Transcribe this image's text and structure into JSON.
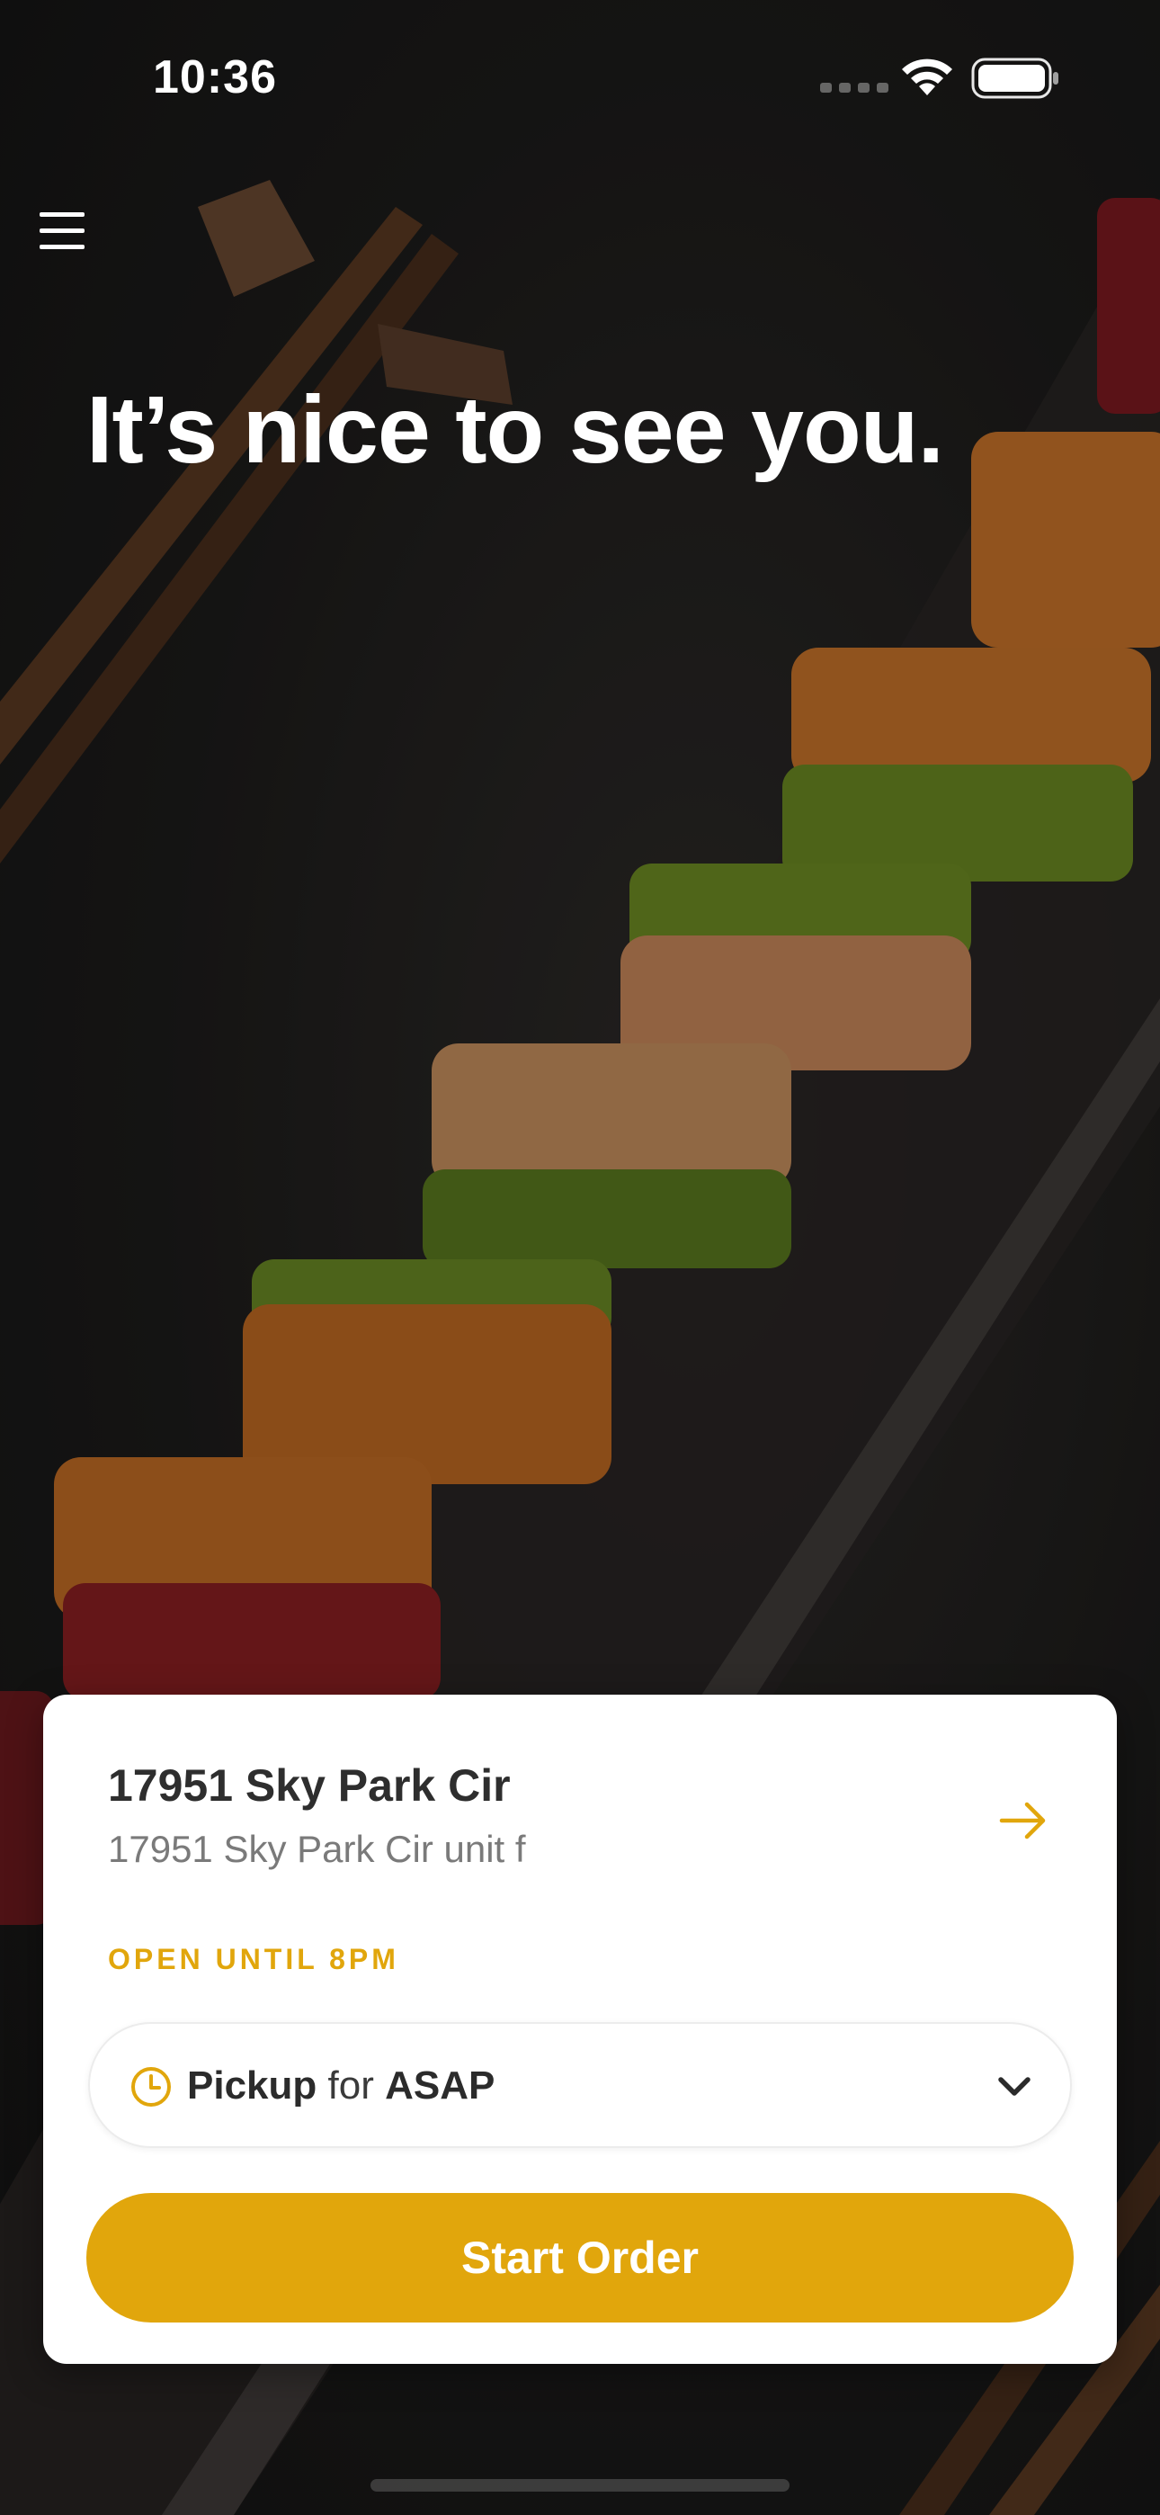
{
  "status_bar": {
    "time": "10:36"
  },
  "hero": {
    "greeting": "It’s nice to see you."
  },
  "location": {
    "name": "17951 Sky Park Cir",
    "address": "17951 Sky Park Cir unit f",
    "hours": "OPEN UNTIL 8PM"
  },
  "order": {
    "mode": "Pickup",
    "connector": "for",
    "time": "ASAP",
    "start_label": "Start Order"
  },
  "colors": {
    "accent": "#e1a60c",
    "card": "#ffffff",
    "text_dark": "#2e2e2e",
    "text_muted": "#7a7a7a"
  },
  "icons": [
    "menu-icon",
    "arrow-right-icon",
    "clock-icon",
    "chevron-down-icon",
    "wifi-icon",
    "battery-icon"
  ]
}
